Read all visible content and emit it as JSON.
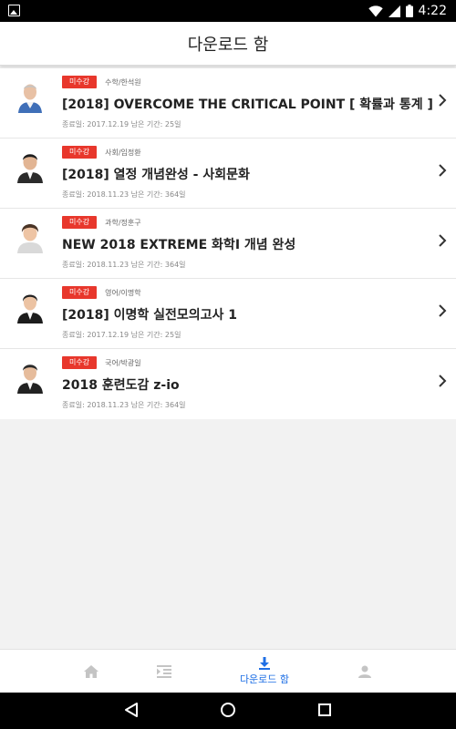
{
  "status": {
    "time": "4:22"
  },
  "header": {
    "title": "다운로드 함"
  },
  "downloads": [
    {
      "badge": "미수강",
      "subject": "수학/한석원",
      "title": "[2018] OVERCOME THE CRITICAL POINT [ 확률과 통계 ]",
      "info": "종료일: 2017.12.19 남은 기간: 25일"
    },
    {
      "badge": "미수강",
      "subject": "사회/임정환",
      "title": "[2018] 열정 개념완성 - 사회문화",
      "info": "종료일: 2018.11.23 남은 기간: 364일"
    },
    {
      "badge": "미수강",
      "subject": "과학/정훈구",
      "title": "NEW 2018 EXTREME 화학I 개념 완성",
      "info": "종료일: 2018.11.23 남은 기간: 364일"
    },
    {
      "badge": "미수강",
      "subject": "영어/이명학",
      "title": "[2018] 이명학 실전모의고사 1",
      "info": "종료일: 2017.12.19 남은 기간: 25일"
    },
    {
      "badge": "미수강",
      "subject": "국어/박광일",
      "title": "2018 훈련도감 z-io",
      "info": "종료일: 2018.11.23 남은 기간: 364일"
    }
  ],
  "tabbar": {
    "home_icon": "home-icon",
    "list_icon": "lecture-list-icon",
    "download_icon": "download-icon",
    "download_label": "다운로드 함",
    "profile_icon": "profile-icon",
    "active_color": "#1f6fe5"
  },
  "colors": {
    "badge": "#e8372c",
    "accent": "#1f6fe5"
  }
}
